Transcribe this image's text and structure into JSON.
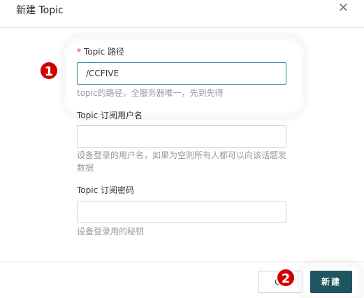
{
  "dialog": {
    "title": "新建 Topic",
    "close_icon": "close-icon"
  },
  "form": {
    "topic_path": {
      "required_mark": "*",
      "label": "Topic 路径",
      "value": "/CCFIVE",
      "help": "topic的路径，全服务器唯一，先到先得"
    },
    "subscribe_user": {
      "label": "Topic 订阅用户名",
      "value": "",
      "help": "设备登录的用户名，如果为空则所有人都可以向该话题发数据"
    },
    "subscribe_password": {
      "label": "Topic 订阅密码",
      "value": "",
      "help": "设备登录用的秘钥"
    }
  },
  "footer": {
    "cancel_label": "Ca",
    "create_label": "新建"
  },
  "annotations": {
    "step1": "1",
    "step2": "2"
  },
  "colors": {
    "primary": "#1f5560",
    "required": "#e0202e",
    "badge": "#d00000",
    "focus_border": "#2e8ca0"
  }
}
